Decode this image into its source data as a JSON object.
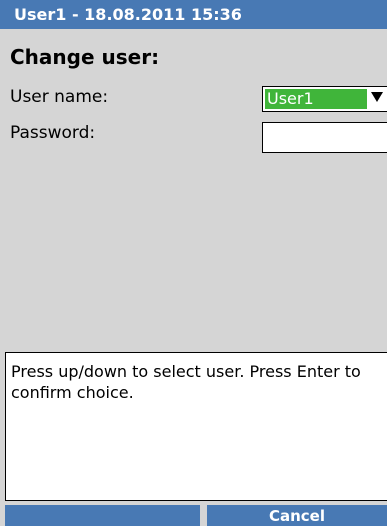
{
  "title_bar": {
    "text": "User1 - 18.08.2011 15:36"
  },
  "dialog": {
    "heading": "Change user:",
    "user_name_label": "User name:",
    "user_name_value": "User1",
    "password_label": "Password:",
    "password_value": ""
  },
  "help": {
    "text": "Press up/down to select user. Press Enter to confirm choice."
  },
  "softkeys": {
    "left_label": "",
    "right_label": "Cancel"
  },
  "colors": {
    "title_bar": "#4879b4",
    "selected_value": "#40b53a",
    "background": "#d5d5d5"
  },
  "icons": {
    "dropdown": "triangle-down"
  }
}
